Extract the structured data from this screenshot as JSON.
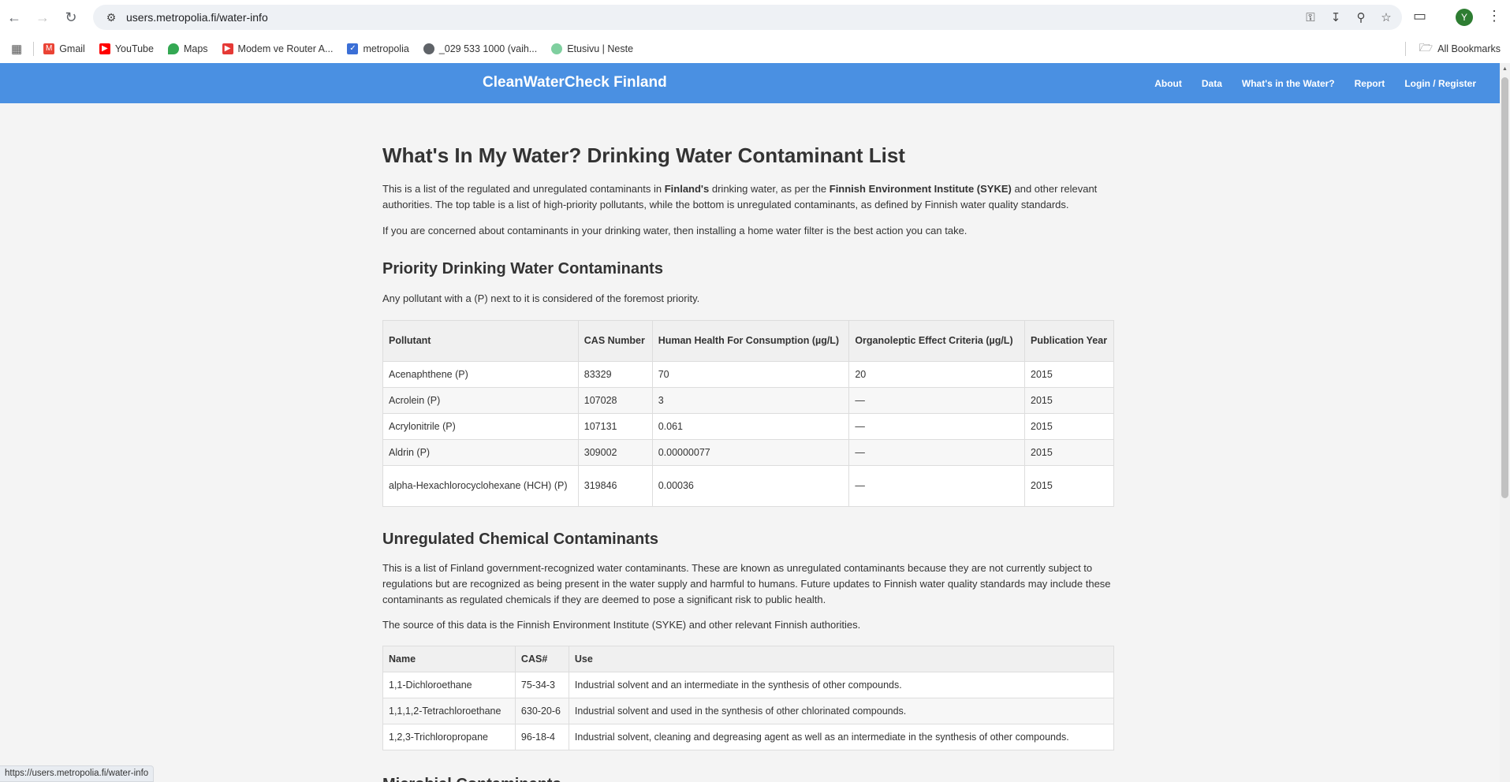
{
  "browser": {
    "url": "users.metropolia.fi/water-info",
    "avatar_letter": "Y",
    "status_url": "https://users.metropolia.fi/water-info",
    "bookmarks": [
      {
        "label": "Gmail",
        "color": "#ea4335"
      },
      {
        "label": "YouTube",
        "color": "#ff0000"
      },
      {
        "label": "Maps",
        "color": "#34a853"
      },
      {
        "label": "Modem ve Router A...",
        "color": "#e53935"
      },
      {
        "label": "metropolia",
        "color": "#3b6fd6"
      },
      {
        "label": "_029 533 1000 (vaih...",
        "color": "#5f6368"
      },
      {
        "label": "Etusivu | Neste",
        "color": "#7fcf9f"
      }
    ],
    "all_bookmarks": "All Bookmarks"
  },
  "site": {
    "title": "CleanWaterCheck Finland",
    "nav": [
      "About",
      "Data",
      "What's in the Water?",
      "Report",
      "Login / Register"
    ]
  },
  "page": {
    "heading": "What's In My Water? Drinking Water Contaminant List",
    "intro_1": "This is a list of the regulated and unregulated contaminants in ",
    "intro_bold_1": "Finland's",
    "intro_2": " drinking water, as per the ",
    "intro_bold_2": "Finnish Environment Institute (SYKE)",
    "intro_3": " and other relevant authorities. The top table is a list of high-priority pollutants, while the bottom is unregulated contaminants, as defined by Finnish water quality standards.",
    "concern": "If you are concerned about contaminants in your drinking water, then installing a home water filter is the best action you can take.",
    "priority": {
      "heading": "Priority Drinking Water Contaminants",
      "note": "Any pollutant with a (P) next to it is considered of the foremost priority.",
      "headers": [
        "Pollutant",
        "CAS Number",
        "Human Health For Consumption (µg/L)",
        "Organoleptic Effect Criteria (µg/L)",
        "Publication Year"
      ],
      "rows": [
        [
          "Acenaphthene (P)",
          "83329",
          "70",
          "20",
          "2015"
        ],
        [
          "Acrolein (P)",
          "107028",
          "3",
          "—",
          "2015"
        ],
        [
          "Acrylonitrile (P)",
          "107131",
          "0.061",
          "—",
          "2015"
        ],
        [
          "Aldrin (P)",
          "309002",
          "0.00000077",
          "—",
          "2015"
        ],
        [
          "alpha-Hexachlorocyclohexane (HCH) (P)",
          "319846",
          "0.00036",
          "—",
          "2015"
        ]
      ]
    },
    "unregulated": {
      "heading": "Unregulated Chemical Contaminants",
      "description": "This is a list of Finland government-recognized water contaminants. These are known as unregulated contaminants because they are not currently subject to regulations but are recognized as being present in the water supply and harmful to humans. Future updates to Finnish water quality standards may include these contaminants as regulated chemicals if they are deemed to pose a significant risk to public health.",
      "source": "The source of this data is the Finnish Environment Institute (SYKE) and other relevant Finnish authorities.",
      "headers": [
        "Name",
        "CAS#",
        "Use"
      ],
      "rows": [
        [
          "1,1-Dichloroethane",
          "75-34-3",
          "Industrial solvent and an intermediate in the synthesis of other compounds."
        ],
        [
          "1,1,1,2-Tetrachloroethane",
          "630-20-6",
          "Industrial solvent and used in the synthesis of other chlorinated compounds."
        ],
        [
          "1,2,3-Trichloropropane",
          "96-18-4",
          "Industrial solvent, cleaning and degreasing agent as well as an intermediate in the synthesis of other compounds."
        ]
      ]
    },
    "next_heading": "Microbial Contaminants"
  }
}
